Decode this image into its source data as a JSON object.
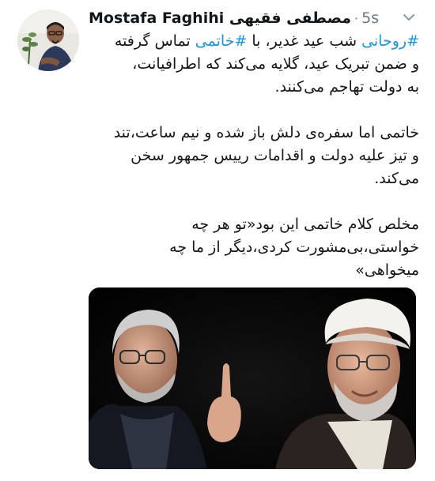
{
  "header": {
    "display_name_en": "Mostafa Faghihi",
    "display_name_fa": "مصطفی فقیهی",
    "separator": "·",
    "timestamp": "5s"
  },
  "icons": {
    "more": "chevron-down-icon"
  },
  "body": {
    "p1": {
      "l1_tag1": "#روحانی",
      "l1_mid": " شب عید غدیر، با ",
      "l1_tag2": "#خاتمی",
      "l1_end": " تماس گرفته",
      "l2": "و ضمن تبریک عید، گلایه می‌کند که اطرافیانت،",
      "l3": "به دولت تهاجم می‌کنند."
    },
    "p2": {
      "l1": "خاتمی اما سفره‌ی دلش باز شده و نیم ساعت،تند",
      "l2": "و تیز علیه دولت و اقدامات رییس جمهور سخن",
      "l3": "می‌کند."
    },
    "p3": {
      "l1": "مخلص کلام خاتمی این بود«تو هر چه",
      "l2": "خواستی،بی‌مشورت کردی،دیگر از ما چه",
      "l3": "میخواهی»"
    }
  },
  "colors": {
    "hashtag": "#1b95e0",
    "secondary_text": "#657786",
    "primary_text": "#14171a"
  }
}
